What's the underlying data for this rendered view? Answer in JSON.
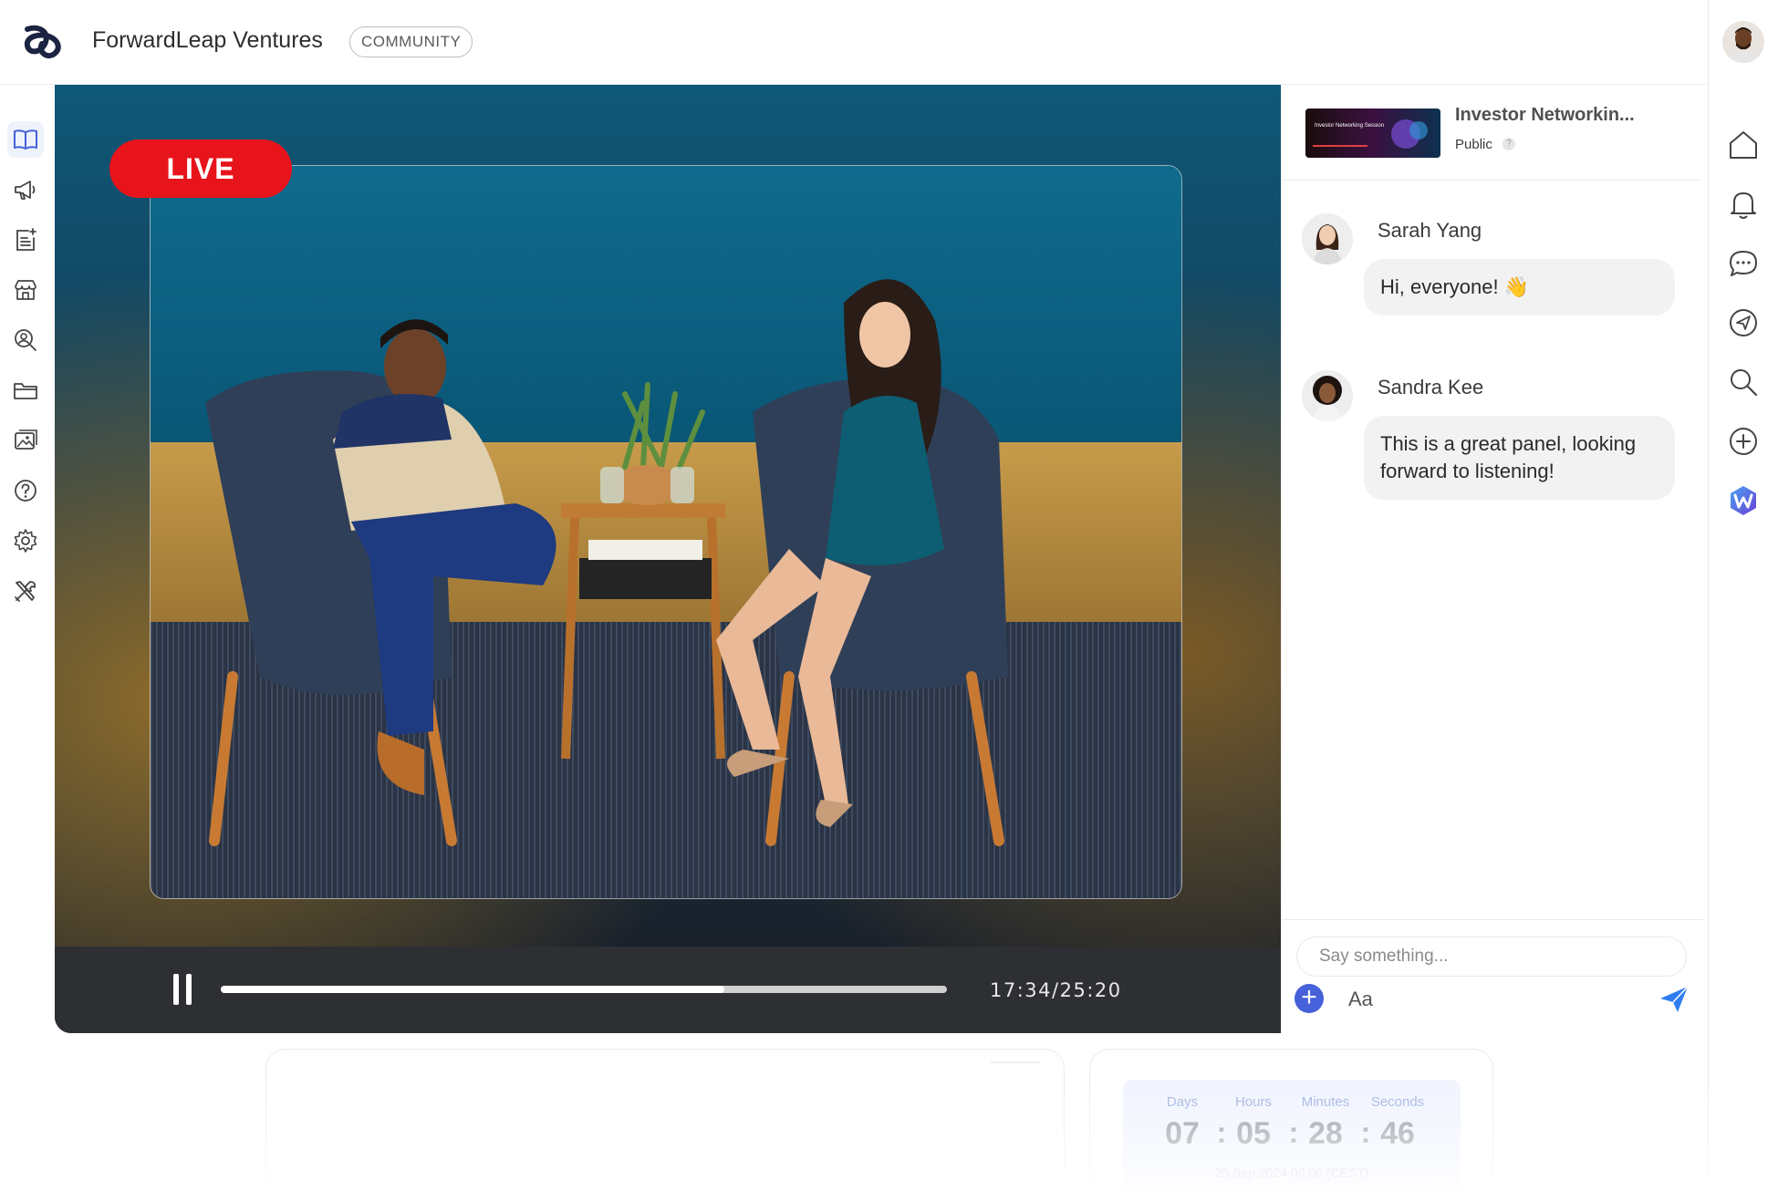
{
  "header": {
    "app_title": "ForwardLeap Ventures",
    "badge": "COMMUNITY",
    "logo_icon": "forwardleap-logo",
    "user_avatar_icon": "user-avatar"
  },
  "left_sidebar": {
    "items": [
      {
        "icon": "book-icon",
        "active": true
      },
      {
        "icon": "megaphone-icon"
      },
      {
        "icon": "add-post-icon"
      },
      {
        "icon": "store-icon"
      },
      {
        "icon": "people-search-icon"
      },
      {
        "icon": "folder-icon"
      },
      {
        "icon": "gallery-icon"
      },
      {
        "icon": "help-icon"
      },
      {
        "icon": "settings-icon"
      },
      {
        "icon": "tools-icon"
      }
    ]
  },
  "video": {
    "live_label": "LIVE",
    "time_readout": "17:34/25:20",
    "progress": 0.6937,
    "state": "playing",
    "colors": {
      "live": "#e8141b",
      "controls_bg": "#2d2f33"
    }
  },
  "chat": {
    "event": {
      "title": "Investor Networkin...",
      "visibility": "Public",
      "thumb_caption": "Investor Networking Session"
    },
    "messages": [
      {
        "author": "Sarah Yang",
        "text": "Hi, everyone! 👋"
      },
      {
        "author": "Sandra Kee",
        "text": "This is a great panel, looking forward to listening!"
      }
    ],
    "input_placeholder": "Say something...",
    "format_label": "Aa",
    "accent": "#4661d9"
  },
  "right_rail": {
    "items": [
      {
        "icon": "home-icon"
      },
      {
        "icon": "bell-icon"
      },
      {
        "icon": "chat-icon"
      },
      {
        "icon": "navigation-icon"
      },
      {
        "icon": "search-icon"
      },
      {
        "icon": "add-circle-icon"
      },
      {
        "icon": "app-w-icon"
      }
    ]
  },
  "countdown": {
    "labels": {
      "days": "Days",
      "hours": "Hours",
      "minutes": "Minutes",
      "seconds": "Seconds"
    },
    "values": {
      "days": "07",
      "hours": "05",
      "minutes": "28",
      "seconds": "46"
    },
    "separator": ":",
    "date": "25 Sep 2024 00:00 (CEST)"
  }
}
